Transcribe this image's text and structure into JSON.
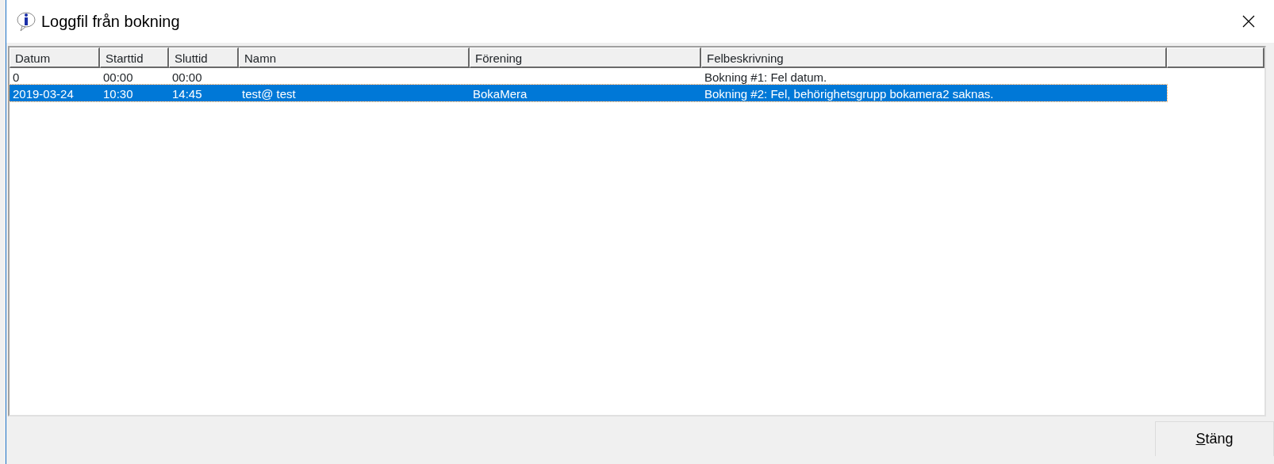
{
  "window": {
    "title": "Loggfil från bokning"
  },
  "table": {
    "columns": [
      "Datum",
      "Starttid",
      "Sluttid",
      "Namn",
      "Förening",
      "Felbeskrivning"
    ],
    "rows": [
      {
        "cells": [
          "0",
          "00:00",
          "00:00",
          "",
          "",
          "Bokning #1: Fel datum."
        ],
        "selected": false
      },
      {
        "cells": [
          "2019-03-24",
          "10:30",
          "14:45",
          "test@ test",
          "BokaMera",
          "Bokning #2: Fel, behörighetsgrupp bokamera2 saknas."
        ],
        "selected": true
      }
    ]
  },
  "buttons": [
    {
      "label": "Stäng"
    }
  ]
}
